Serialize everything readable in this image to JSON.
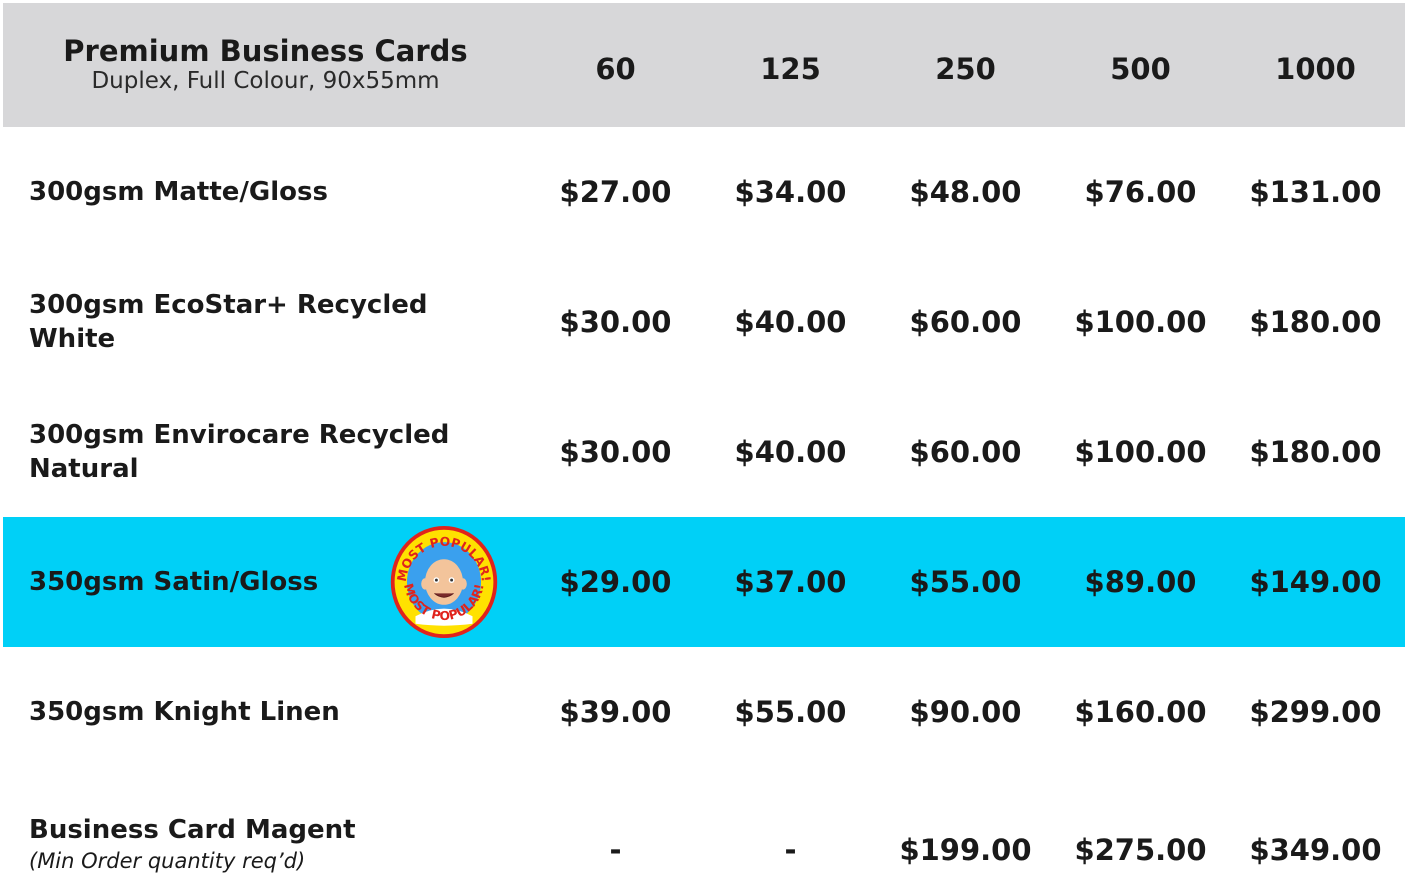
{
  "header": {
    "title": "Premium Business Cards",
    "subtitle": "Duplex, Full Colour, 90x55mm",
    "quantities": [
      "60",
      "125",
      "250",
      "500",
      "1000"
    ]
  },
  "rows": [
    {
      "label": "300gsm Matte/Gloss",
      "note": "",
      "prices": [
        "$27.00",
        "$34.00",
        "$48.00",
        "$76.00",
        "$131.00"
      ]
    },
    {
      "label": "300gsm EcoStar+ Recycled White",
      "note": "",
      "prices": [
        "$30.00",
        "$40.00",
        "$60.00",
        "$100.00",
        "$180.00"
      ]
    },
    {
      "label": "300gsm Envirocare Recycled Natural",
      "note": "",
      "prices": [
        "$30.00",
        "$40.00",
        "$60.00",
        "$100.00",
        "$180.00"
      ]
    },
    {
      "label": "350gsm Satin/Gloss",
      "note": "",
      "prices": [
        "$29.00",
        "$37.00",
        "$55.00",
        "$89.00",
        "$149.00"
      ],
      "highlighted": true
    },
    {
      "label": "350gsm Knight Linen",
      "note": "",
      "prices": [
        "$39.00",
        "$55.00",
        "$90.00",
        "$160.00",
        "$299.00"
      ]
    },
    {
      "label": "Business Card Magent",
      "note": "(Min Order quantity req’d)",
      "prices": [
        "-",
        "-",
        "$199.00",
        "$275.00",
        "$349.00"
      ]
    }
  ],
  "badge": {
    "text": "MOST POPULAR!",
    "icon": "bald-man-avatar-icon"
  },
  "colors": {
    "header_bg": "#d7d7d9",
    "highlight_bg": "#00d0f7",
    "badge_ring": "#ffe100",
    "badge_border": "#e0231c"
  }
}
